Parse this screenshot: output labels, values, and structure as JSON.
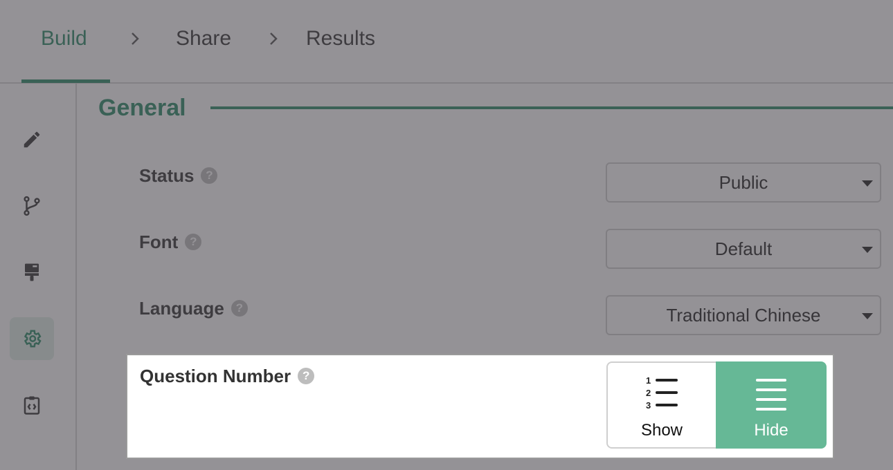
{
  "nav": {
    "tabs": [
      {
        "label": "Build",
        "active": true
      },
      {
        "label": "Share",
        "active": false
      },
      {
        "label": "Results",
        "active": false
      }
    ]
  },
  "rail": {
    "items": [
      {
        "icon": "pencil-icon",
        "active": false
      },
      {
        "icon": "branch-icon",
        "active": false
      },
      {
        "icon": "paint-brush-icon",
        "active": false
      },
      {
        "icon": "gear-icon",
        "active": true
      },
      {
        "icon": "code-clipboard-icon",
        "active": false
      }
    ]
  },
  "section": {
    "title": "General"
  },
  "settings": {
    "status": {
      "label": "Status",
      "value": "Public"
    },
    "font": {
      "label": "Font",
      "value": "Default"
    },
    "language": {
      "label": "Language",
      "value": "Traditional Chinese"
    },
    "question_number": {
      "label": "Question Number",
      "options": [
        {
          "label": "Show",
          "icon": "numbered-list-icon",
          "selected": false
        },
        {
          "label": "Hide",
          "icon": "list-icon",
          "selected": true
        }
      ]
    }
  },
  "help_glyph": "?",
  "colors": {
    "accent": "#2a8a66",
    "toggle_selected": "#66b896",
    "overlay": "rgba(70,68,74,0.58)"
  }
}
